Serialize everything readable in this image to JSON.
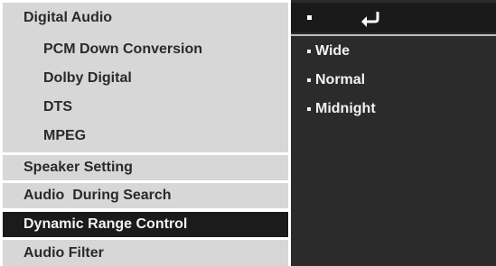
{
  "left_menu": {
    "digital_audio": {
      "label": "Digital Audio",
      "sub_items": [
        "PCM Down Conversion",
        "Dolby Digital",
        "DTS",
        "MPEG"
      ]
    },
    "speaker_setting": "Speaker Setting",
    "audio_during_search": "Audio  During Search",
    "dynamic_range_control": "Dynamic Range Control",
    "audio_filter": "Audio Filter",
    "selected": "Dynamic Range Control"
  },
  "right_panel": {
    "header_icon": "return-arrow-icon",
    "options": [
      "Wide",
      "Normal",
      "Midnight"
    ]
  },
  "colors": {
    "menu_bg": "#d7d7d7",
    "selected_bg": "#1b1b1b",
    "panel_bg": "#2b2b2b",
    "text_dark": "#2a2a2a",
    "text_light": "#f2f2f2"
  }
}
